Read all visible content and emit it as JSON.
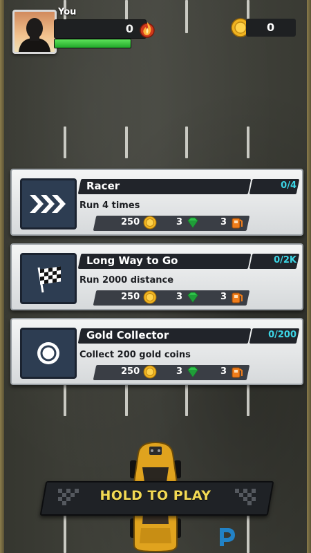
{
  "hud": {
    "player_name": "You",
    "score": "0",
    "energy_progress": 1.0,
    "coin_count": "0"
  },
  "missions": [
    {
      "title": "Racer",
      "progress": "0/4",
      "description": "Run 4 times",
      "icon": "chevrons-icon",
      "rewards": {
        "coins": "250",
        "gems": "3",
        "fuel": "3"
      }
    },
    {
      "title": "Long Way to Go",
      "progress": "0/2K",
      "description": "Run 2000 distance",
      "icon": "checkered-flag-icon",
      "rewards": {
        "coins": "250",
        "gems": "3",
        "fuel": "3"
      }
    },
    {
      "title": "Gold Collector",
      "progress": "0/200",
      "description": "Collect 200 gold coins",
      "icon": "coin-ring-icon",
      "rewards": {
        "coins": "250",
        "gems": "3",
        "fuel": "3"
      }
    }
  ],
  "play_button": {
    "label": "HOLD TO PLAY"
  },
  "colors": {
    "accent_yellow": "#f3da54",
    "progress_cyan": "#3cd6e6",
    "energy_green": "#2fbf35",
    "card_bg": "#e6e8ea"
  }
}
